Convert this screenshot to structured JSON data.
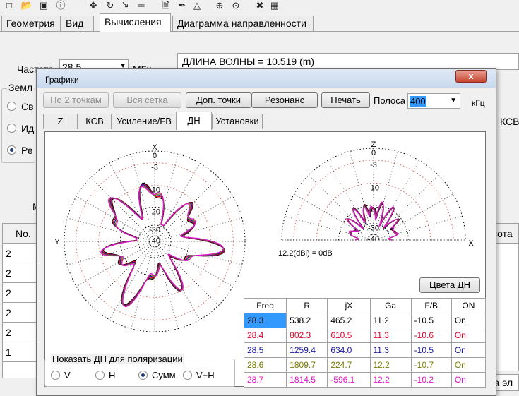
{
  "toolbar": {
    "icons": [
      "new-icon",
      "open-icon",
      "save-icon",
      "info-icon",
      "move-icon",
      "rotate-icon",
      "resize-icon",
      "segments-icon",
      "document-icon",
      "draw-icon",
      "triangle-icon",
      "crosshair-icon",
      "target-icon",
      "tools-icon",
      "calculator-icon"
    ]
  },
  "main_tabs": [
    "Геометрия",
    "Вид",
    "Вычисления",
    "Диаграмма направленности"
  ],
  "main": {
    "freq_label": "Частота",
    "freq_value": "28.5",
    "freq_unit": "МГц",
    "wavelength": "ДЛИНА ВОЛНЫ = 10.519 (m)",
    "ground_group": "Земл",
    "radio_labels": [
      "Св",
      "Ид",
      "Ре"
    ],
    "m_label": "М",
    "kcb_label": "КСВ",
    "table_header": "No.",
    "table_rows": [
      "2",
      "2",
      "2",
      "2",
      "2",
      "1"
    ],
    "right_col_header": "сота",
    "bottom_right_text": "ка эл"
  },
  "dialog": {
    "title": "Графики",
    "close_label": "x",
    "buttons": {
      "two_points": "По 2 точкам",
      "full_grid": "Вся сетка",
      "extra_points": "Доп. точки",
      "resonance": "Резонанс",
      "print": "Печать"
    },
    "band_label": "Полоса",
    "band_value": "400",
    "band_unit": "кГц",
    "tabs": [
      "Z",
      "КСВ",
      "Усиление/FB",
      "ДН",
      "Установки"
    ],
    "plot": {
      "horizontal": {
        "top": "X",
        "left": "Y",
        "rings": [
          "0",
          "-3",
          "-10",
          "-20",
          "-30",
          "-40"
        ]
      },
      "vertical": {
        "top": "Z",
        "right": "X",
        "rings": [
          "0",
          "-3",
          "-10",
          "-20",
          "-30",
          "-40"
        ]
      },
      "ref_label": "12.2(dBi) = 0dB"
    },
    "colors_button": "Цвета ДН",
    "table": {
      "headers": [
        "Freq",
        "R",
        "jX",
        "Ga",
        "F/B",
        "ON"
      ],
      "rows": [
        {
          "cells": [
            "28.3",
            "538.2",
            "465.2",
            "11.2",
            "-10.5",
            "On"
          ],
          "color": "#000000"
        },
        {
          "cells": [
            "28.4",
            "802.3",
            "610.5",
            "11.3",
            "-10.6",
            "On"
          ],
          "color": "#e0002a"
        },
        {
          "cells": [
            "28.5",
            "1259.4",
            "634.0",
            "11.3",
            "-10.5",
            "On"
          ],
          "color": "#1a1aa8"
        },
        {
          "cells": [
            "28.6",
            "1809.7",
            "224.7",
            "12.2",
            "-10.7",
            "On"
          ],
          "color": "#7a7a00"
        },
        {
          "cells": [
            "28.7",
            "1814.5",
            "-596.1",
            "12.2",
            "-10.2",
            "On"
          ],
          "color": "#e010d0"
        }
      ]
    },
    "polarization": {
      "caption": "Показать ДН для поляризации",
      "options": [
        "V",
        "H",
        "Сумм.",
        "V+H"
      ],
      "selected": "Сумм."
    }
  }
}
